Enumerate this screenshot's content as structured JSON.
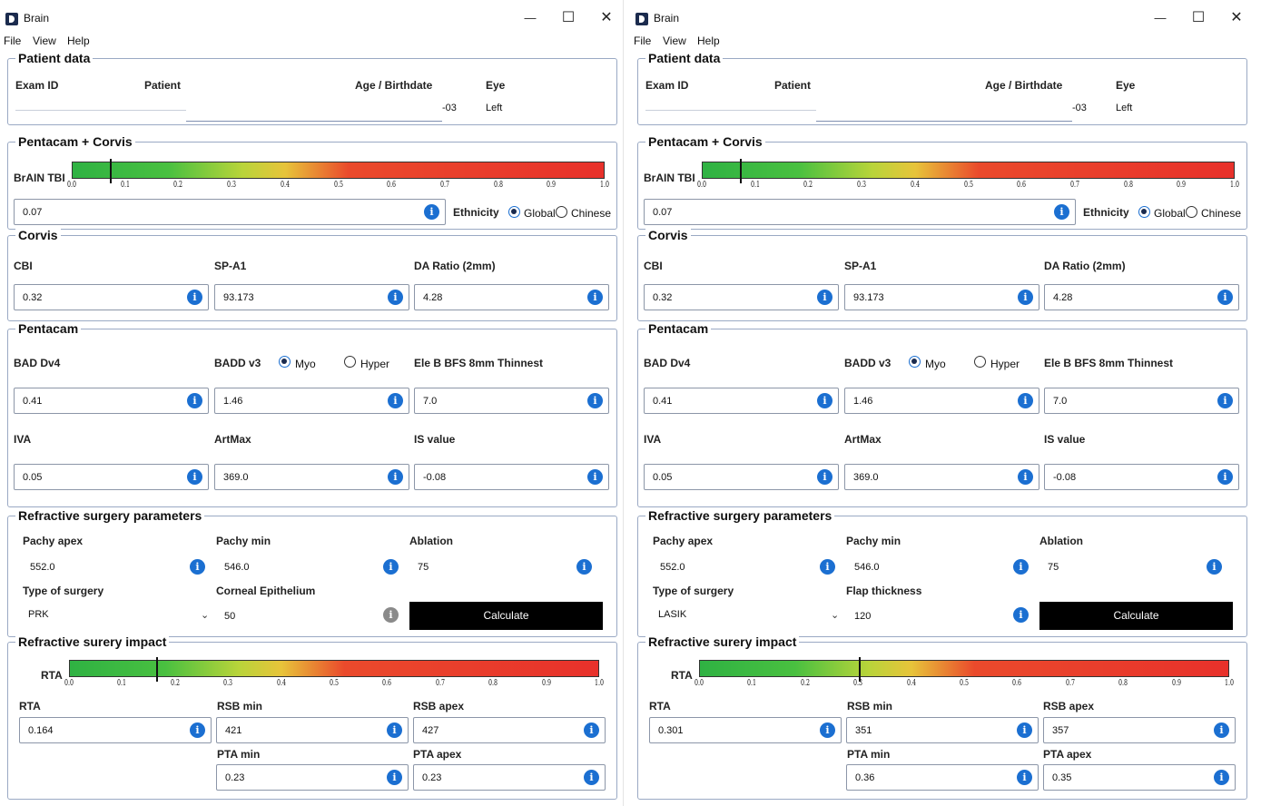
{
  "windows": [
    {
      "title": "Brain",
      "menu": [
        "File",
        "View",
        "Help"
      ],
      "patient": {
        "header": "Patient data",
        "exam_id_label": "Exam ID",
        "patient_label": "Patient",
        "age_label": "Age / Birthdate",
        "eye_label": "Eye",
        "age_value": "-03",
        "eye_value": "Left"
      },
      "tbi": {
        "header": "Pentacam + Corvis",
        "bar_label": "BrAIN TBI",
        "value": "0.07",
        "marker": 0.07,
        "ethnicity_label": "Ethnicity",
        "opt_global": "Global",
        "opt_chinese": "Chinese",
        "selected": "Global"
      },
      "corvis": {
        "header": "Corvis",
        "cbi_label": "CBI",
        "cbi": "0.32",
        "spa1_label": "SP-A1",
        "spa1": "93.173",
        "da_label": "DA Ratio (2mm)",
        "da": "4.28"
      },
      "pentacam": {
        "header": "Pentacam",
        "bad_label": "BAD Dv4",
        "bad": "0.41",
        "badd_label": "BADD v3",
        "opt_myo": "Myo",
        "opt_hyper": "Hyper",
        "selected": "Myo",
        "ele_label": "Ele B BFS 8mm Thinnest",
        "badd": "1.46",
        "ele": "7.0",
        "iva_label": "IVA",
        "iva": "0.05",
        "artmax_label": "ArtMax",
        "artmax": "369.0",
        "is_label": "IS value",
        "is": "-0.08"
      },
      "surgery": {
        "header": "Refractive surgery parameters",
        "pachy_apex_label": "Pachy apex",
        "pachy_apex": "552.0",
        "pachy_min_label": "Pachy min",
        "pachy_min": "546.0",
        "ablation_label": "Ablation",
        "ablation": "75",
        "type_label": "Type of surgery",
        "type": "PRK",
        "extra_label": "Corneal Epithelium",
        "extra": "50",
        "calculate": "Calculate"
      },
      "impact": {
        "header": "Refractive surery impact",
        "bar_label": "RTA",
        "marker": 0.164,
        "rta_label": "RTA",
        "rta": "0.164",
        "rsb_min_label": "RSB min",
        "rsb_min": "421",
        "rsb_apex_label": "RSB apex",
        "rsb_apex": "427",
        "pta_min_label": "PTA min",
        "pta_min": "0.23",
        "pta_apex_label": "PTA apex",
        "pta_apex": "0.23"
      }
    },
    {
      "title": "Brain",
      "menu": [
        "File",
        "View",
        "Help"
      ],
      "patient": {
        "header": "Patient data",
        "exam_id_label": "Exam ID",
        "patient_label": "Patient",
        "age_label": "Age / Birthdate",
        "eye_label": "Eye",
        "age_value": "-03",
        "eye_value": "Left"
      },
      "tbi": {
        "header": "Pentacam + Corvis",
        "bar_label": "BrAIN TBI",
        "value": "0.07",
        "marker": 0.07,
        "ethnicity_label": "Ethnicity",
        "opt_global": "Global",
        "opt_chinese": "Chinese",
        "selected": "Global"
      },
      "corvis": {
        "header": "Corvis",
        "cbi_label": "CBI",
        "cbi": "0.32",
        "spa1_label": "SP-A1",
        "spa1": "93.173",
        "da_label": "DA Ratio (2mm)",
        "da": "4.28"
      },
      "pentacam": {
        "header": "Pentacam",
        "bad_label": "BAD Dv4",
        "bad": "0.41",
        "badd_label": "BADD v3",
        "opt_myo": "Myo",
        "opt_hyper": "Hyper",
        "selected": "Myo",
        "ele_label": "Ele B BFS 8mm Thinnest",
        "badd": "1.46",
        "ele": "7.0",
        "iva_label": "IVA",
        "iva": "0.05",
        "artmax_label": "ArtMax",
        "artmax": "369.0",
        "is_label": "IS value",
        "is": "-0.08"
      },
      "surgery": {
        "header": "Refractive surgery parameters",
        "pachy_apex_label": "Pachy apex",
        "pachy_apex": "552.0",
        "pachy_min_label": "Pachy min",
        "pachy_min": "546.0",
        "ablation_label": "Ablation",
        "ablation": "75",
        "type_label": "Type of surgery",
        "type": "LASIK",
        "extra_label": "Flap thickness",
        "extra": "120",
        "calculate": "Calculate"
      },
      "impact": {
        "header": "Refractive surery impact",
        "bar_label": "RTA",
        "marker": 0.301,
        "rta_label": "RTA",
        "rta": "0.301",
        "rsb_min_label": "RSB min",
        "rsb_min": "351",
        "rsb_apex_label": "RSB apex",
        "rsb_apex": "357",
        "pta_min_label": "PTA min",
        "pta_min": "0.36",
        "pta_apex_label": "PTA apex",
        "pta_apex": "0.35"
      }
    }
  ],
  "scale_ticks": [
    "0.0",
    "0.1",
    "0.2",
    "0.3",
    "0.4",
    "0.5",
    "0.6",
    "0.7",
    "0.8",
    "0.9",
    "1.0"
  ]
}
